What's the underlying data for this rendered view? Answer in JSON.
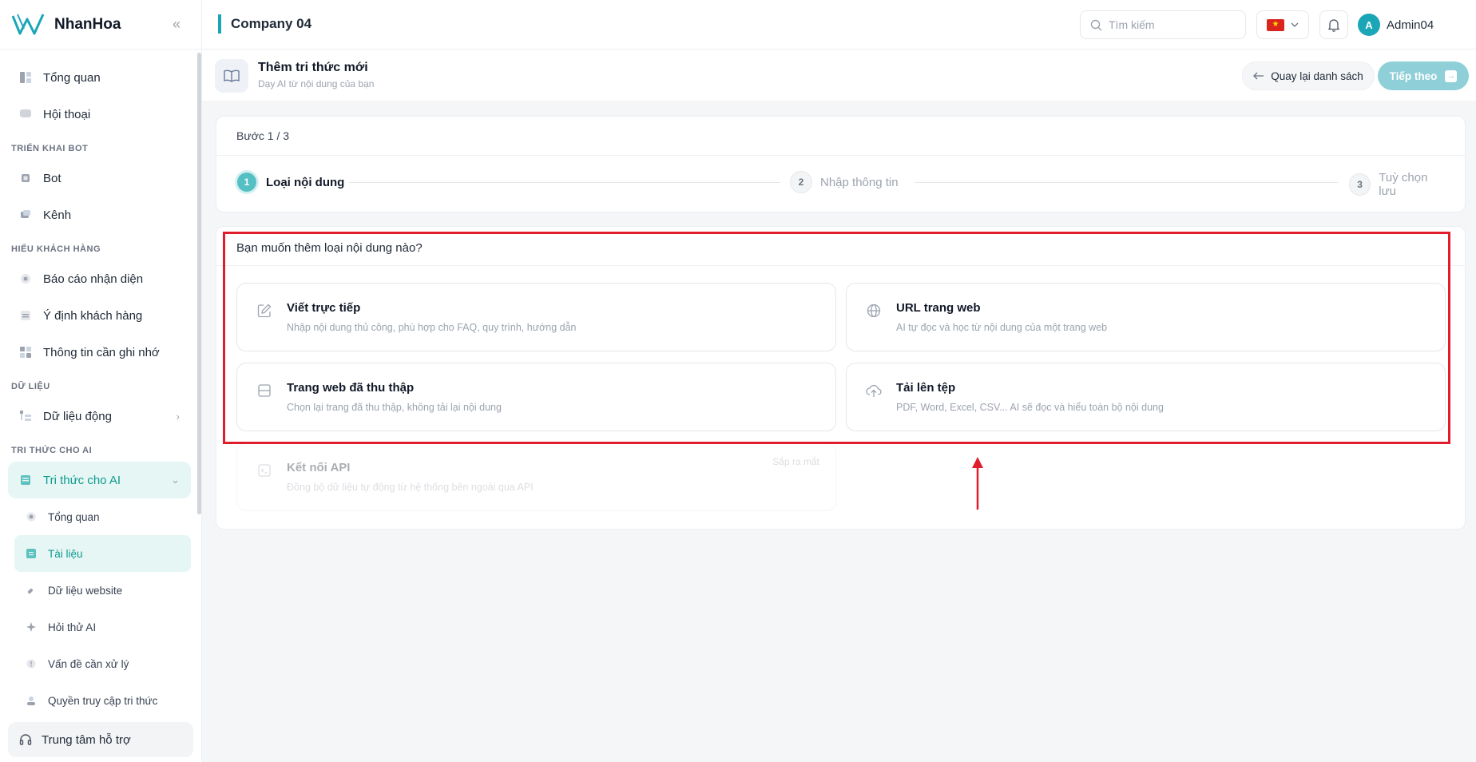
{
  "brand": {
    "name": "NhanHoa"
  },
  "sidebar": {
    "top_items": [
      {
        "label": "Tổng quan",
        "icon": "dashboard-icon"
      },
      {
        "label": "Hội thoại",
        "icon": "chat-icon"
      }
    ],
    "sections": [
      {
        "label": "TRIỂN KHAI BOT",
        "items": [
          {
            "label": "Bot"
          },
          {
            "label": "Kênh"
          }
        ]
      },
      {
        "label": "HIỂU KHÁCH HÀNG",
        "items": [
          {
            "label": "Báo cáo nhận diện"
          },
          {
            "label": "Ý định khách hàng"
          },
          {
            "label": "Thông tin cần ghi nhớ"
          }
        ]
      },
      {
        "label": "DỮ LIỆU",
        "items": [
          {
            "label": "Dữ liệu động"
          }
        ]
      },
      {
        "label": "TRI THỨC CHO AI",
        "items": [
          {
            "label": "Tri thức cho AI"
          }
        ]
      }
    ],
    "sub_items": [
      {
        "label": "Tổng quan"
      },
      {
        "label": "Tài liệu"
      },
      {
        "label": "Dữ liệu website"
      },
      {
        "label": "Hỏi thử AI"
      },
      {
        "label": "Vấn đề cần xử lý"
      },
      {
        "label": "Quyền truy cập tri thức"
      }
    ],
    "support": "Trung tâm hỗ trợ"
  },
  "header": {
    "company": "Company 04",
    "search_placeholder": "Tìm kiếm",
    "language_flag": "vietnam-flag-icon",
    "user": {
      "initial": "A",
      "name": "Admin04"
    }
  },
  "page": {
    "title": "Thêm tri thức mới",
    "subtitle": "Dạy AI từ nội dung của bạn",
    "back_label": "Quay lại danh sách",
    "next_label": "Tiếp theo"
  },
  "steps": {
    "label": "Bước 1 / 3",
    "items": [
      {
        "num": "1",
        "label": "Loại nội dung"
      },
      {
        "num": "2",
        "label": "Nhập thông tin"
      },
      {
        "num": "3",
        "label": "Tuỳ chọn lưu"
      }
    ]
  },
  "content": {
    "question": "Bạn muốn thêm loại nội dung nào?",
    "options": [
      {
        "title": "Viết trực tiếp",
        "desc": "Nhập nội dung thủ công, phù hợp cho FAQ, quy trình, hướng dẫn",
        "icon": "edit-icon"
      },
      {
        "title": "URL trang web",
        "desc": "AI tự đọc và học từ nội dung của một trang web",
        "icon": "globe-icon"
      },
      {
        "title": "Trang web đã thu thập",
        "desc": "Chọn lại trang đã thu thập, không tải lại nội dung",
        "icon": "browser-icon"
      },
      {
        "title": "Tải lên tệp",
        "desc": "PDF, Word, Excel, CSV... AI sẽ đọc và hiểu toàn bộ nội dung",
        "icon": "upload-icon"
      },
      {
        "title": "Kết nối API",
        "desc": "Đồng bộ dữ liệu tự động từ hệ thống bên ngoài qua API",
        "badge": "Sắp ra mắt",
        "icon": "terminal-icon"
      }
    ]
  },
  "colors": {
    "accent": "#1aa6b7",
    "active_bg": "#e6f6f4",
    "highlight": "#e01e2b"
  }
}
